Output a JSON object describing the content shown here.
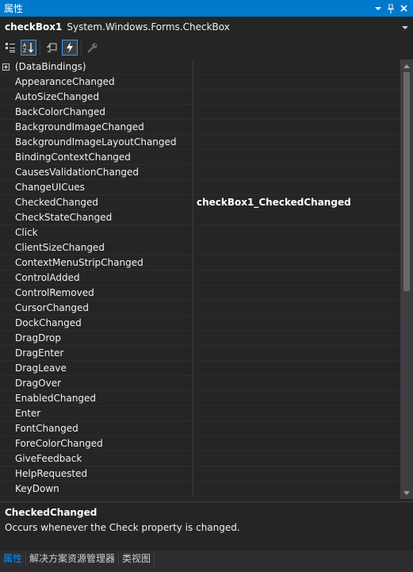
{
  "window": {
    "title": "属性"
  },
  "object_selector": {
    "name": "checkBox1",
    "type": "System.Windows.Forms.CheckBox"
  },
  "toolbar": {
    "buttons": [
      {
        "icon": "categorized-icon",
        "active": false
      },
      {
        "icon": "alphabetical-icon",
        "active": true
      },
      {
        "icon": "properties-icon",
        "active": false
      },
      {
        "icon": "events-lightning-icon",
        "active": true
      },
      {
        "icon": "property-pages-wrench-icon",
        "active": false
      }
    ]
  },
  "events": [
    {
      "name": "(DataBindings)",
      "value": "",
      "expandable": true
    },
    {
      "name": "AppearanceChanged",
      "value": ""
    },
    {
      "name": "AutoSizeChanged",
      "value": ""
    },
    {
      "name": "BackColorChanged",
      "value": ""
    },
    {
      "name": "BackgroundImageChanged",
      "value": ""
    },
    {
      "name": "BackgroundImageLayoutChanged",
      "value": ""
    },
    {
      "name": "BindingContextChanged",
      "value": ""
    },
    {
      "name": "CausesValidationChanged",
      "value": ""
    },
    {
      "name": "ChangeUICues",
      "value": ""
    },
    {
      "name": "CheckedChanged",
      "value": "checkBox1_CheckedChanged"
    },
    {
      "name": "CheckStateChanged",
      "value": ""
    },
    {
      "name": "Click",
      "value": ""
    },
    {
      "name": "ClientSizeChanged",
      "value": ""
    },
    {
      "name": "ContextMenuStripChanged",
      "value": ""
    },
    {
      "name": "ControlAdded",
      "value": ""
    },
    {
      "name": "ControlRemoved",
      "value": ""
    },
    {
      "name": "CursorChanged",
      "value": ""
    },
    {
      "name": "DockChanged",
      "value": ""
    },
    {
      "name": "DragDrop",
      "value": ""
    },
    {
      "name": "DragEnter",
      "value": ""
    },
    {
      "name": "DragLeave",
      "value": ""
    },
    {
      "name": "DragOver",
      "value": ""
    },
    {
      "name": "EnabledChanged",
      "value": ""
    },
    {
      "name": "Enter",
      "value": ""
    },
    {
      "name": "FontChanged",
      "value": ""
    },
    {
      "name": "ForeColorChanged",
      "value": ""
    },
    {
      "name": "GiveFeedback",
      "value": ""
    },
    {
      "name": "HelpRequested",
      "value": ""
    },
    {
      "name": "KeyDown",
      "value": ""
    }
  ],
  "description": {
    "title": "CheckedChanged",
    "text": "Occurs whenever the Check property is changed."
  },
  "bottom_tabs": [
    {
      "label": "属性",
      "active": true
    },
    {
      "label": "解决方案资源管理器",
      "active": false
    },
    {
      "label": "类视图",
      "active": false
    }
  ],
  "colors": {
    "title_bar": "#007acc",
    "background": "#252526",
    "active_tab_text": "#0097fb",
    "scroll_thumb": "#686868"
  }
}
